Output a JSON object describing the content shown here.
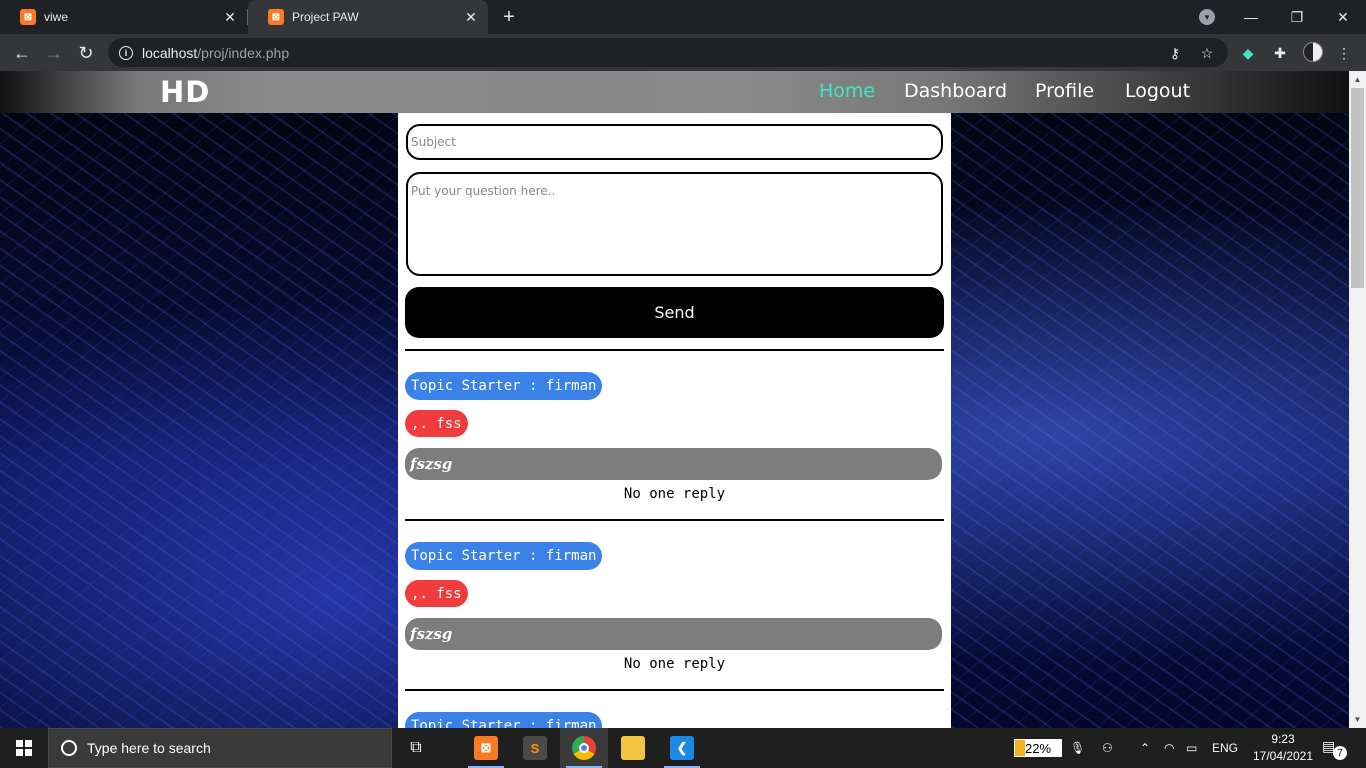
{
  "browser": {
    "tabs": [
      {
        "title": "viwe",
        "favicon": "xampp-icon"
      },
      {
        "title": "Project PAW",
        "favicon": "xampp-icon"
      }
    ],
    "url_host": "localhost",
    "url_path": "/proj/index.php"
  },
  "site": {
    "logo": "HD",
    "nav": {
      "home": "Home",
      "dashboard": "Dashboard",
      "profile": "Profile",
      "logout": "Logout"
    },
    "accent_color": "#3ee8c6"
  },
  "form": {
    "subject_placeholder": "Subject",
    "question_placeholder": "Put your question here..",
    "send_label": "Send"
  },
  "posts": [
    {
      "starter": "Topic Starter : firman",
      "subject": ",. fss",
      "question": "fszsg",
      "reply": "No one reply"
    },
    {
      "starter": "Topic Starter : firman",
      "subject": ",. fss",
      "question": "fszsg",
      "reply": "No one reply"
    },
    {
      "starter": "Topic Starter : firman"
    }
  ],
  "colors": {
    "starter_badge": "#3b82e8",
    "subject_badge": "#f03c3c",
    "question_bar": "#7d7d7d"
  },
  "taskbar": {
    "search_placeholder": "Type here to search",
    "battery": "22%",
    "language": "ENG",
    "time": "9:23",
    "date": "17/04/2021",
    "notification_count": "7"
  }
}
